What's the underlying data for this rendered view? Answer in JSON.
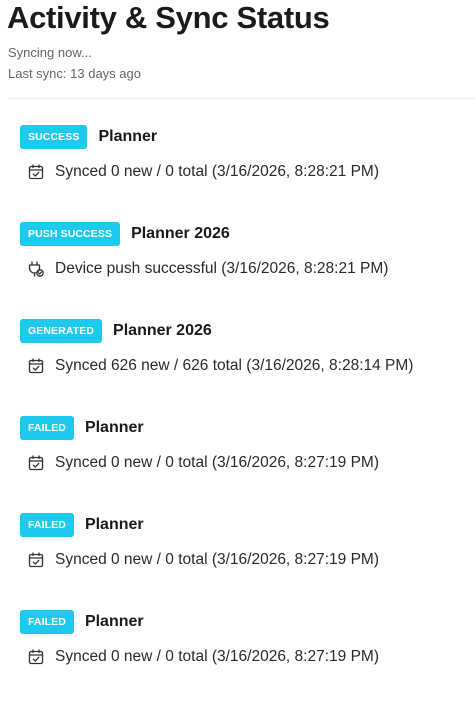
{
  "header": {
    "title": "Activity & Sync Status",
    "status_text": "Syncing now...",
    "last_sync_text": "Last sync: 13 days ago"
  },
  "colors": {
    "badge_background": "#1ec9ee",
    "badge_text": "#ffffff"
  },
  "entries": [
    {
      "badge": "SUCCESS",
      "title": "Planner",
      "icon": "calendar-check-icon",
      "detail": "Synced 0 new / 0 total (3/16/2026, 8:28:21 PM)"
    },
    {
      "badge": "PUSH SUCCESS",
      "title": "Planner 2026",
      "icon": "plug-check-icon",
      "detail": "Device push successful (3/16/2026, 8:28:21 PM)"
    },
    {
      "badge": "GENERATED",
      "title": "Planner 2026",
      "icon": "calendar-check-icon",
      "detail": "Synced 626 new / 626 total (3/16/2026, 8:28:14 PM)"
    },
    {
      "badge": "FAILED",
      "title": "Planner",
      "icon": "calendar-check-icon",
      "detail": "Synced 0 new / 0 total (3/16/2026, 8:27:19 PM)"
    },
    {
      "badge": "FAILED",
      "title": "Planner",
      "icon": "calendar-check-icon",
      "detail": "Synced 0 new / 0 total (3/16/2026, 8:27:19 PM)"
    },
    {
      "badge": "FAILED",
      "title": "Planner",
      "icon": "calendar-check-icon",
      "detail": "Synced 0 new / 0 total (3/16/2026, 8:27:19 PM)"
    }
  ]
}
